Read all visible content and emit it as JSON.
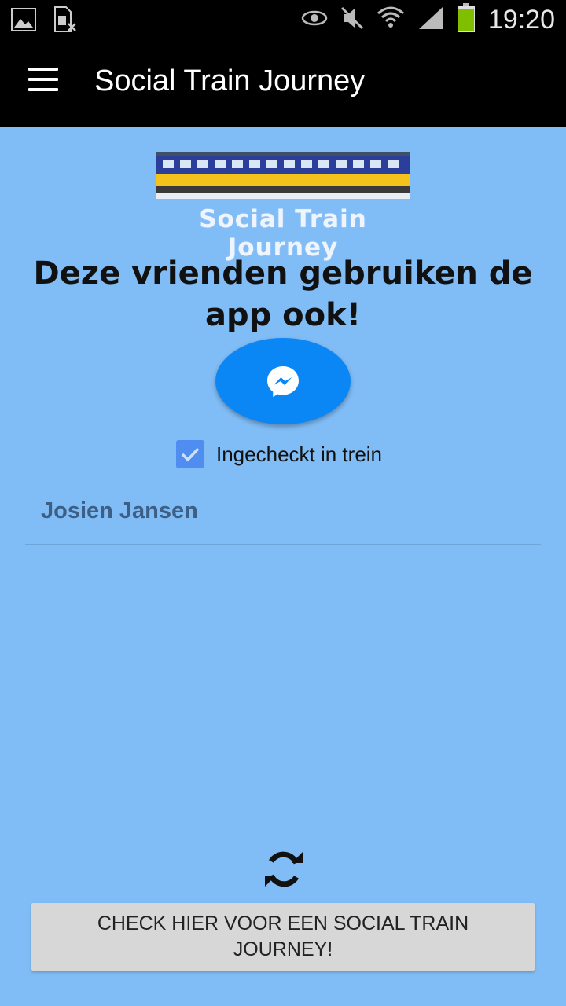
{
  "status_bar": {
    "time": "19:20",
    "icons": [
      "gallery-icon",
      "sim-card-icon",
      "eye-icon",
      "mute-icon",
      "wifi-icon",
      "signal-icon",
      "battery-icon"
    ],
    "battery_color": "#7fbf00"
  },
  "app_bar": {
    "title": "Social Train Journey",
    "menu_icon": "hamburger-menu-icon"
  },
  "logo": {
    "text": "Social Train Journey"
  },
  "main": {
    "heading": "Deze vrienden gebruiken de app ook!",
    "messenger_icon": "messenger-icon",
    "checkbox": {
      "label": "Ingecheckt in trein",
      "checked": true
    },
    "friends": [
      "Josien Jansen"
    ]
  },
  "footer": {
    "refresh_icon": "refresh-icon",
    "button_label": "CHECK HIER VOOR EEN SOCIAL TRAIN JOURNEY!"
  },
  "colors": {
    "background": "#80bcf5",
    "app_bar": "#000000",
    "messenger_button": "#0b86f5",
    "checkbox": "#4f8ef0",
    "button": "#d7d7d7"
  }
}
